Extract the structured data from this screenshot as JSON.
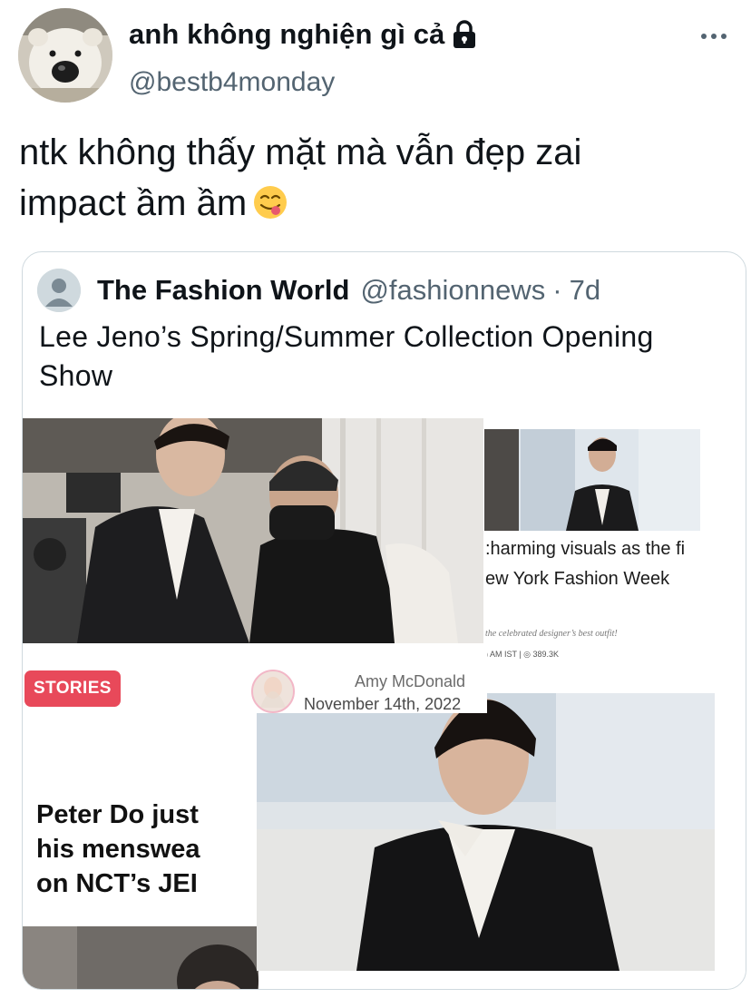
{
  "tweet": {
    "display_name": "anh không nghiện gì cả",
    "handle": "@bestb4monday",
    "text_line1": "ntk không thấy mặt mà vẫn đẹp zai",
    "text_line2": "impact ầm ầm",
    "icons": [
      "lock-icon",
      "more-icon",
      "face-savoring-food-emoji"
    ]
  },
  "quote": {
    "name": "The Fashion World",
    "handle": "@fashionnews",
    "separator": "·",
    "time": "7d",
    "text": "Lee Jeno’s Spring/Summer Collection Opening Show"
  },
  "collage": {
    "stories_badge": "STORIES",
    "author_name": "Amy McDonald",
    "author_date": "November 14th, 2022",
    "headline": "Peter Do just\nhis menswea\non NCT’s JEI",
    "caption": ":harming visuals as the fi\new York Fashion Week",
    "subcaption": "the celebrated designer’s best outfit!",
    "meta": ") AM IST | ◎ 389.3K"
  },
  "colors": {
    "text": "#0f1419",
    "secondary": "#536471",
    "border": "#cfd9de",
    "stories": "#e8495a"
  }
}
